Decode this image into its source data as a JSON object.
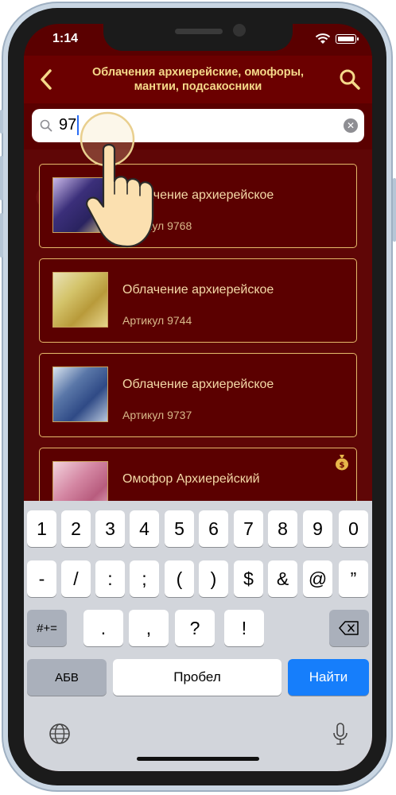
{
  "status_bar": {
    "time": "1:14"
  },
  "nav": {
    "title": "Облачения архиерейские, омофоры, мантии, подсакосники",
    "back_icon": "chevron-left-icon",
    "search_icon": "search-icon"
  },
  "search": {
    "value": "97"
  },
  "products": [
    {
      "title": "Облачение архиерейское",
      "sku": "Артикул 9768"
    },
    {
      "title": "Облачение архиерейское",
      "sku": "Артикул 9744"
    },
    {
      "title": "Облачение архиерейское",
      "sku": "Артикул 9737"
    },
    {
      "title": "Омофор Архиерейский",
      "sku": "",
      "badge_icon": "money-bag-icon"
    }
  ],
  "keyboard": {
    "row1": [
      "1",
      "2",
      "3",
      "4",
      "5",
      "6",
      "7",
      "8",
      "9",
      "0"
    ],
    "row2": [
      "-",
      "/",
      ":",
      ";",
      "(",
      ")",
      "$",
      "&",
      "@",
      "”"
    ],
    "row3_left": "#+=",
    "row3": [
      ".",
      ",",
      "?",
      "!"
    ],
    "alpha_label": "АБВ",
    "space_label": "Пробел",
    "go_label": "Найти"
  },
  "colors": {
    "nav_bg": "#6b0000",
    "title_gold": "#f5d98a",
    "card_border": "#e4b96a",
    "go_key": "#167efb"
  }
}
